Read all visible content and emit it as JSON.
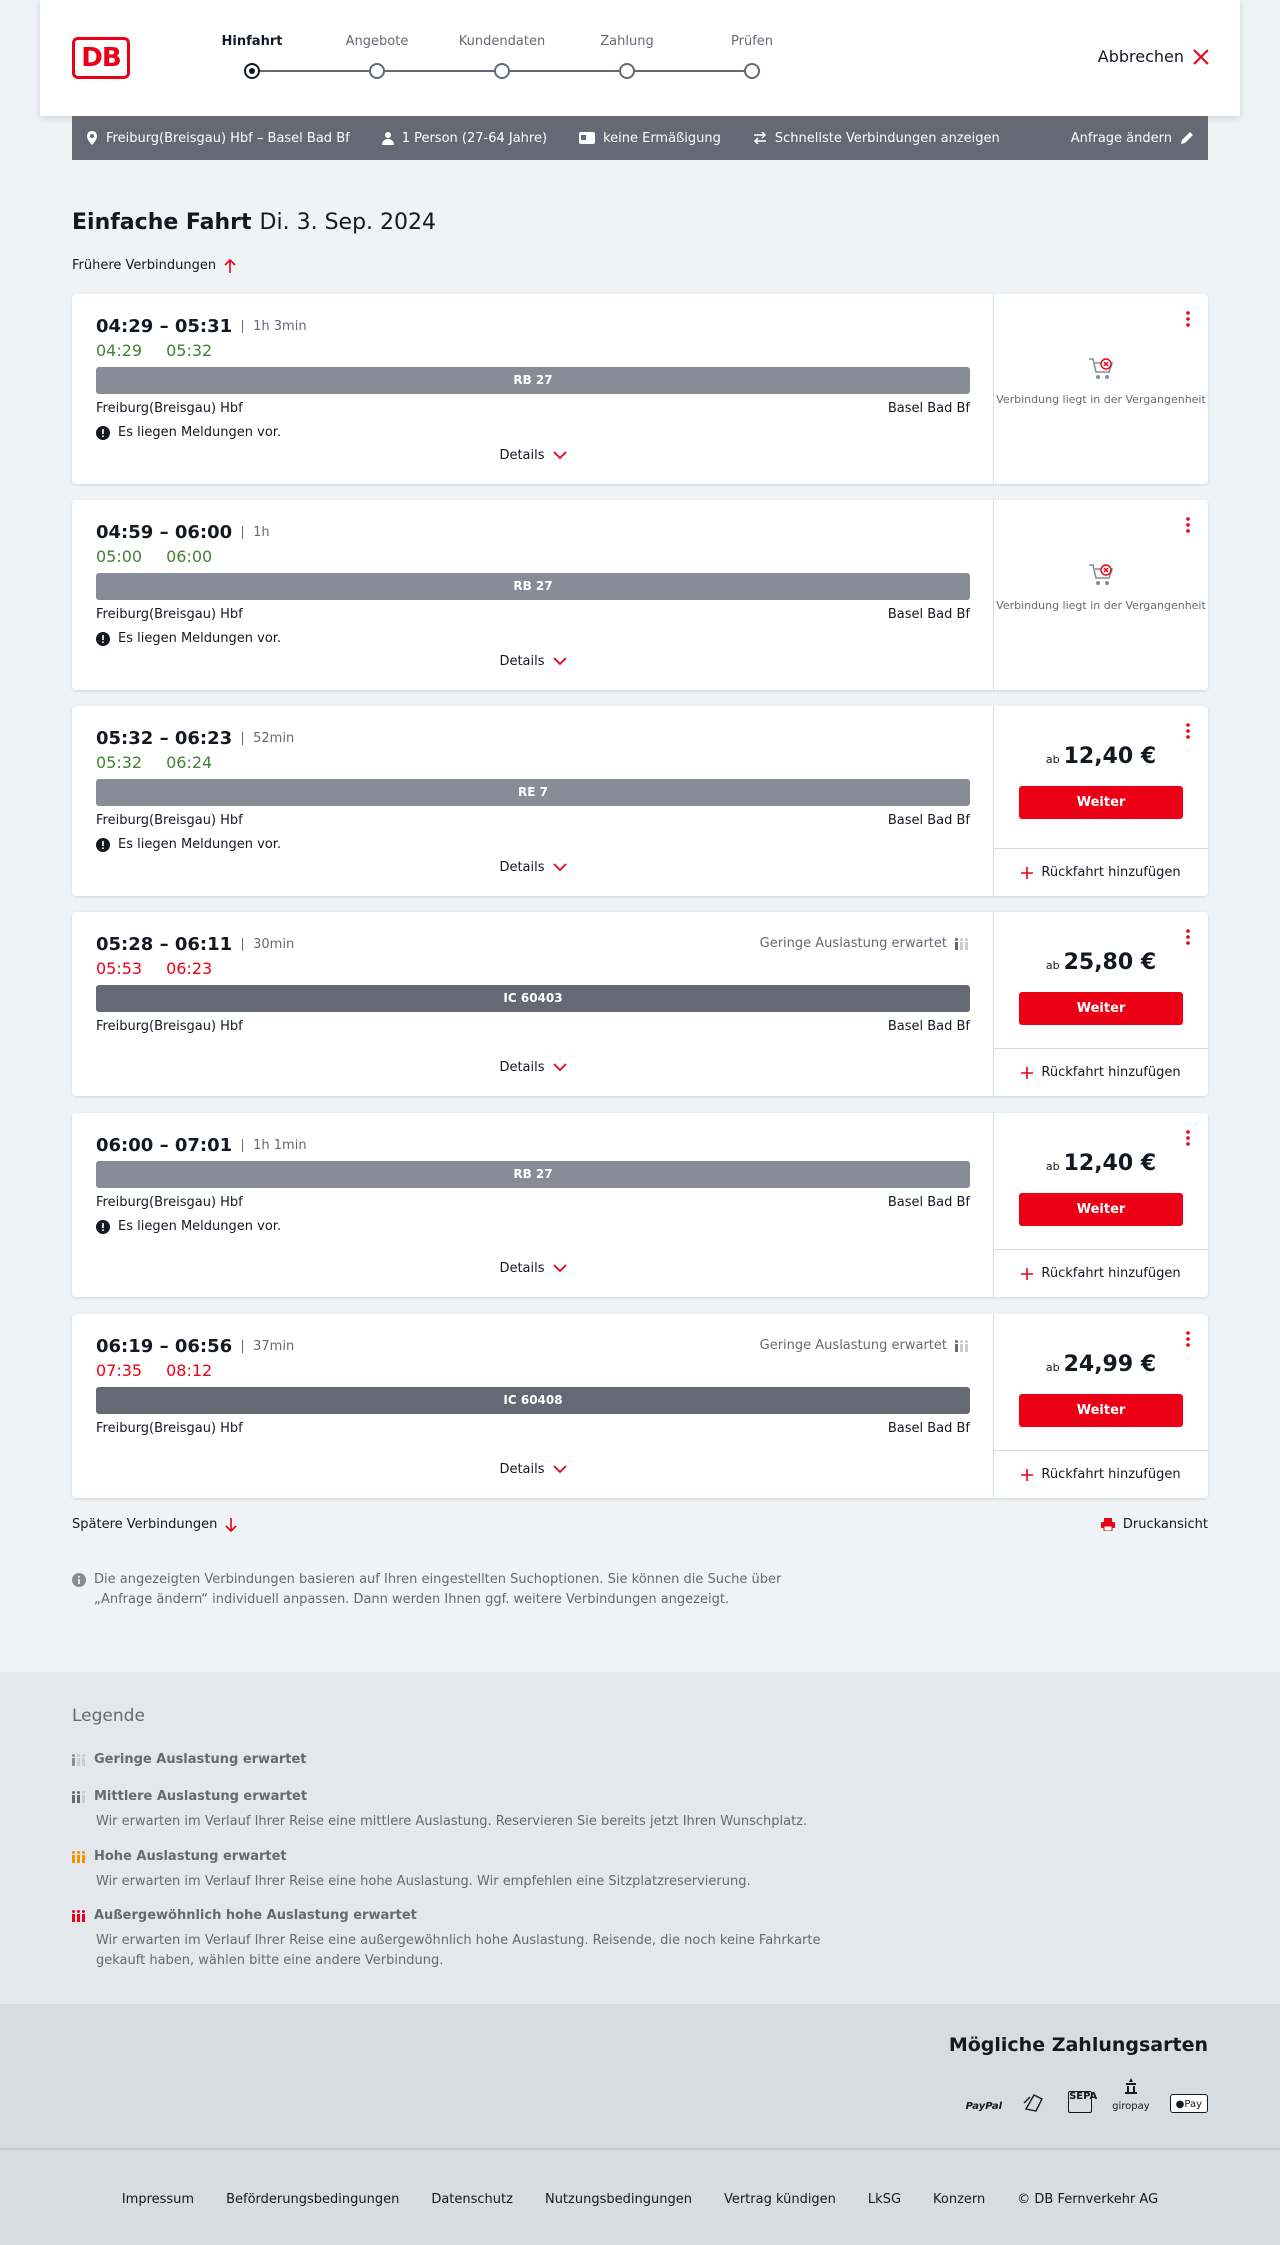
{
  "header": {
    "logo": "DB",
    "cancel_label": "Abbrechen",
    "steps": [
      {
        "label": "Hinfahrt"
      },
      {
        "label": "Angebote"
      },
      {
        "label": "Kundendaten"
      },
      {
        "label": "Zahlung"
      },
      {
        "label": "Prüfen"
      }
    ]
  },
  "query": {
    "route": "Freiburg(Breisgau) Hbf – Basel Bad Bf",
    "persons": "1 Person (27-64 Jahre)",
    "discount": "keine Ermäßigung",
    "fastest": "Schnellste Verbindungen anzeigen",
    "change": "Anfrage ändern"
  },
  "page": {
    "title": "Einfache Fahrt",
    "date": "Di. 3. Sep. 2024",
    "earlier": "Frühere Verbindungen",
    "later": "Spätere Verbindungen",
    "print": "Druckansicht",
    "note": "Die angezeigten Verbindungen basieren auf Ihren eingestellten Suchoptionen. Sie können die Suche über „Anfrage ändern“ individuell anpassen. Dann werden Ihnen ggf. weitere Verbindungen angezeigt."
  },
  "common": {
    "details": "Details",
    "past": "Verbindung liegt in der Vergangenheit",
    "from": "ab",
    "continue": "Weiter",
    "return": "Rückfahrt hinzufügen",
    "messages": "Es liegen Meldungen vor.",
    "util": "Geringe Auslastung erwartet"
  },
  "connections": [
    {
      "times": "04:29 – 05:31",
      "duration": "1h 3min",
      "rt_dep": "04:29",
      "rt_arr": "05:32",
      "rt_status": "ontime",
      "train": "RB 27",
      "from": "Freiburg(Breisgau) Hbf",
      "to": "Basel Bad Bf",
      "has_messages": true,
      "util": false,
      "past": true
    },
    {
      "times": "04:59 – 06:00",
      "duration": "1h",
      "rt_dep": "05:00",
      "rt_arr": "06:00",
      "rt_status": "ontime",
      "train": "RB 27",
      "from": "Freiburg(Breisgau) Hbf",
      "to": "Basel Bad Bf",
      "has_messages": true,
      "util": false,
      "past": true
    },
    {
      "times": "05:32 – 06:23",
      "duration": "52min",
      "rt_dep": "05:32",
      "rt_arr": "06:24",
      "rt_status": "ontime",
      "train": "RE 7",
      "from": "Freiburg(Breisgau) Hbf",
      "to": "Basel Bad Bf",
      "has_messages": true,
      "util": false,
      "past": false,
      "price": "12,40 €"
    },
    {
      "times": "05:28 – 06:11",
      "duration": "30min",
      "rt_dep": "05:53",
      "rt_arr": "06:23",
      "rt_status": "delayed",
      "train": "IC 60403",
      "from": "Freiburg(Breisgau) Hbf",
      "to": "Basel Bad Bf",
      "has_messages": false,
      "util": true,
      "past": false,
      "price": "25,80 €"
    },
    {
      "times": "06:00 – 07:01",
      "duration": "1h 1min",
      "train": "RB 27",
      "from": "Freiburg(Breisgau) Hbf",
      "to": "Basel Bad Bf",
      "has_messages": true,
      "util": false,
      "past": false,
      "price": "12,40 €"
    },
    {
      "times": "06:19 – 06:56",
      "duration": "37min",
      "rt_dep": "07:35",
      "rt_arr": "08:12",
      "rt_status": "delayed",
      "train": "IC 60408",
      "from": "Freiburg(Breisgau) Hbf",
      "to": "Basel Bad Bf",
      "has_messages": false,
      "util": true,
      "past": false,
      "price": "24,99 €"
    }
  ],
  "legend": {
    "title": "Legende",
    "items": [
      {
        "title": "Geringe Auslastung erwartet",
        "desc": "",
        "color": "#878c96"
      },
      {
        "title": "Mittlere Auslastung erwartet",
        "desc": "Wir erwarten im Verlauf Ihrer Reise eine mittlere Auslastung. Reservieren Sie bereits jetzt Ihren Wunschplatz.",
        "color": "#646973"
      },
      {
        "title": "Hohe Auslastung erwartet",
        "desc": "Wir erwarten im Verlauf Ihrer Reise eine hohe Auslastung. Wir empfehlen eine Sitzplatzreservierung.",
        "color": "#f39200"
      },
      {
        "title": "Außergewöhnlich hohe Auslastung erwartet",
        "desc": "Wir erwarten im Verlauf Ihrer Reise eine außergewöhnlich hohe Auslastung. Reisende, die noch keine Fahrkarte gekauft haben, wählen bitte eine andere Verbindung.",
        "color": "#ec0016"
      }
    ]
  },
  "payment": {
    "title": "Mögliche Zahlungsarten",
    "paypal": "PayPal",
    "giropay": "giropay",
    "applepay": "Pay",
    "sepa": "SEPA"
  },
  "footer": {
    "links": [
      "Impressum",
      "Beförderungsbedingungen",
      "Datenschutz",
      "Nutzungsbedingungen",
      "Vertrag kündigen",
      "LkSG",
      "Konzern",
      "© DB Fernverkehr AG"
    ]
  },
  "colors": {
    "brand": "#ec0016",
    "ontime": "#408335",
    "delayed": "#ec0016"
  }
}
